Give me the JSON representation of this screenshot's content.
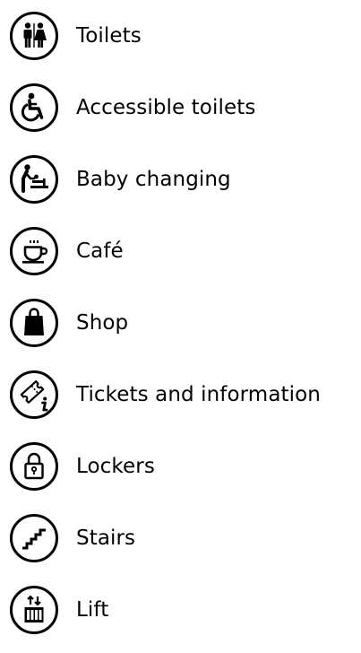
{
  "legend": {
    "items": [
      {
        "icon": "toilets-icon",
        "label": "Toilets"
      },
      {
        "icon": "accessible-toilets-icon",
        "label": "Accessible toilets"
      },
      {
        "icon": "baby-changing-icon",
        "label": "Baby changing"
      },
      {
        "icon": "cafe-icon",
        "label": "Café"
      },
      {
        "icon": "shop-icon",
        "label": "Shop"
      },
      {
        "icon": "tickets-information-icon",
        "label": "Tickets and information"
      },
      {
        "icon": "lockers-icon",
        "label": "Lockers"
      },
      {
        "icon": "stairs-icon",
        "label": "Stairs"
      },
      {
        "icon": "lift-icon",
        "label": "Lift"
      }
    ]
  },
  "colors": {
    "foreground": "#000000",
    "background": "#ffffff"
  }
}
